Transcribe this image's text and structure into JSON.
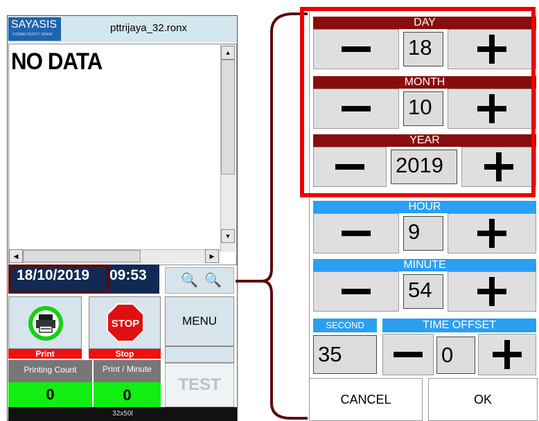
{
  "device": {
    "logo_text": "SAYASIS",
    "logo_tagline": "CODING PURITY SENSE",
    "filename": "pttrijaya_32.ronx",
    "message": "NO DATA",
    "date": "18/10/2019",
    "time": "09:53",
    "print_label": "Print",
    "stop_label": "Stop",
    "stop_sign_text": "STOP",
    "menu_label": "MENU",
    "test_label": "TEST",
    "printing_count_label": "Printing Count",
    "print_per_minute_label": "Print / Minute",
    "printing_count_value": "0",
    "print_per_minute_value": "0",
    "footer_text": "32x50l",
    "scroll_up_icon": "▲",
    "scroll_down_icon": "▼",
    "scroll_left_icon": "◀",
    "scroll_right_icon": "▶"
  },
  "panel": {
    "day_label": "DAY",
    "day_value": "18",
    "month_label": "MONTH",
    "month_value": "10",
    "year_label": "YEAR",
    "year_value": "2019",
    "hour_label": "HOUR",
    "hour_value": "9",
    "minute_label": "MINUTE",
    "minute_value": "54",
    "second_label": "SECOND",
    "second_value": "35",
    "offset_label": "TIME OFFSET",
    "offset_value": "0",
    "cancel_label": "CANCEL",
    "ok_label": "OK"
  },
  "colors": {
    "date_section_header": "#8a0d0d",
    "time_section_header": "#2b9ff2",
    "highlight_border": "#ee0000",
    "callout": "#5a0a0a",
    "counter_green": "#11ee11",
    "label_red": "#ee1111"
  }
}
